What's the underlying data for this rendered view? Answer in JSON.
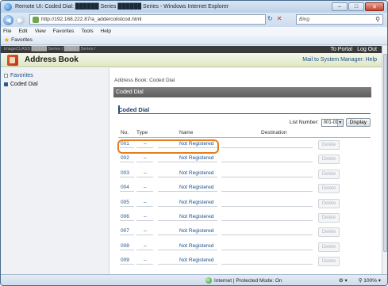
{
  "window": {
    "title": "Remote UI: Coded Dial: ██████ Series ██████ Series - Windows Internet Explorer",
    "buttons": [
      "–",
      "□",
      "✕"
    ]
  },
  "browser": {
    "url": "http://192.168.222.87/a_addercolistcod.html",
    "search_placeholder": "Bing",
    "menu": [
      "File",
      "Edit",
      "View",
      "Favorites",
      "Tools",
      "Help"
    ],
    "favorites_label": "Favorites"
  },
  "site": {
    "brand_text": "imageCLASS █████ Series / █████ Series /",
    "to_portal": "To Portal",
    "log_out": "Log Out",
    "book_title": "Address Book",
    "mail_link": "Mail to System Manager: Help"
  },
  "sidebar": {
    "items": [
      {
        "label": "Favorites",
        "active": false
      },
      {
        "label": "Coded Dial",
        "active": true
      }
    ]
  },
  "main": {
    "breadcrumb": "Address Book: Coded Dial",
    "panel_title": "Coded Dial",
    "section_title": "Coded Dial",
    "list_number_label": "List Number:",
    "list_number_value": "001-014",
    "display_button": "Display",
    "columns": [
      "No.",
      "Type",
      "Name",
      "Destination"
    ],
    "rows": [
      {
        "no": "001",
        "type": "–",
        "name": "Not Registered",
        "delete": "Delete"
      },
      {
        "no": "002",
        "type": "–",
        "name": "Not Registered",
        "delete": "Delete"
      },
      {
        "no": "003",
        "type": "–",
        "name": "Not Registered",
        "delete": "Delete"
      },
      {
        "no": "004",
        "type": "–",
        "name": "Not Registered",
        "delete": "Delete"
      },
      {
        "no": "005",
        "type": "–",
        "name": "Not Registered",
        "delete": "Delete"
      },
      {
        "no": "006",
        "type": "–",
        "name": "Not Registered",
        "delete": "Delete"
      },
      {
        "no": "007",
        "type": "–",
        "name": "Not Registered",
        "delete": "Delete"
      },
      {
        "no": "008",
        "type": "–",
        "name": "Not Registered",
        "delete": "Delete"
      },
      {
        "no": "009",
        "type": "–",
        "name": "Not Registered",
        "delete": "Delete"
      }
    ]
  },
  "status": {
    "zone": "Internet | Protected Mode: On",
    "zoom": "100%"
  },
  "colors": {
    "highlight": "#e07f1c",
    "link": "#1a4f8a",
    "header_dark": "#2b2b2b"
  }
}
